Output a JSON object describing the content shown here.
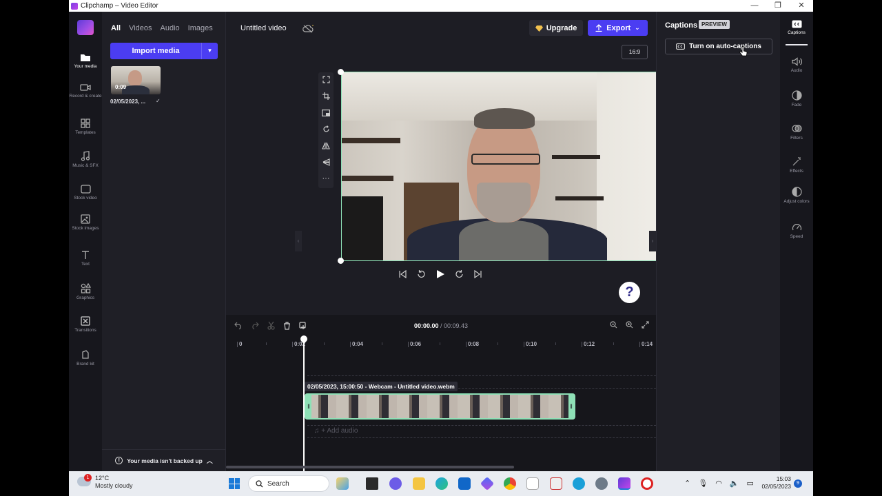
{
  "window": {
    "title": "Clipchamp – Video Editor",
    "minimize": "—",
    "maximize": "❐",
    "close": "✕"
  },
  "rail": {
    "items": [
      {
        "label": "Your media",
        "icon": "folder-icon"
      },
      {
        "label": "Record & create",
        "icon": "camera-icon"
      },
      {
        "label": "Templates",
        "icon": "templates-icon"
      },
      {
        "label": "Music & SFX",
        "icon": "music-icon"
      },
      {
        "label": "Stock video",
        "icon": "film-icon"
      },
      {
        "label": "Stock images",
        "icon": "image-icon"
      },
      {
        "label": "Text",
        "icon": "text-icon"
      },
      {
        "label": "Graphics",
        "icon": "shapes-icon"
      },
      {
        "label": "Transitions",
        "icon": "transition-icon"
      },
      {
        "label": "Brand kit",
        "icon": "brand-icon"
      }
    ]
  },
  "media": {
    "tabs": [
      "All",
      "Videos",
      "Audio",
      "Images"
    ],
    "import_label": "Import media",
    "clip_duration": "0:09",
    "clip_name": "02/05/2023, ...",
    "clip_check": "✓",
    "backup_text": "Your media isn't backed up"
  },
  "header": {
    "project_title": "Untitled video",
    "upgrade_label": "Upgrade",
    "export_label": "Export",
    "ratio_label": "16:9"
  },
  "player": {
    "help_label": "?"
  },
  "timeline": {
    "current_time": "00:00.00",
    "separator": " / ",
    "total_time": "00:09.43",
    "ticks": [
      "0",
      "0:02",
      "0:04",
      "0:06",
      "0:08",
      "0:10",
      "0:12",
      "0:14"
    ],
    "clip_label": "02/05/2023, 15:00:50 - Webcam - Untitled video.webm",
    "add_audio": "+ Add audio"
  },
  "captions": {
    "title": "Captions",
    "badge": "PREVIEW",
    "auto_button": "Turn on auto-captions"
  },
  "props": {
    "items": [
      {
        "label": "Captions",
        "icon": "cc-icon"
      },
      {
        "label": "Audio",
        "icon": "speaker-icon"
      },
      {
        "label": "Fade",
        "icon": "fade-icon"
      },
      {
        "label": "Filters",
        "icon": "filters-icon"
      },
      {
        "label": "Effects",
        "icon": "wand-icon"
      },
      {
        "label": "Adjust colors",
        "icon": "contrast-icon"
      },
      {
        "label": "Speed",
        "icon": "speedometer-icon"
      }
    ]
  },
  "taskbar": {
    "weather_temp": "12°C",
    "weather_cond": "Mostly cloudy",
    "weather_badge": "1",
    "search_label": "Search",
    "time": "15:03",
    "date": "02/05/2023",
    "notif_count": "9"
  },
  "colors": {
    "accent": "#4b3df2",
    "selection": "#8ee0b6",
    "background": "#1d1d24"
  }
}
